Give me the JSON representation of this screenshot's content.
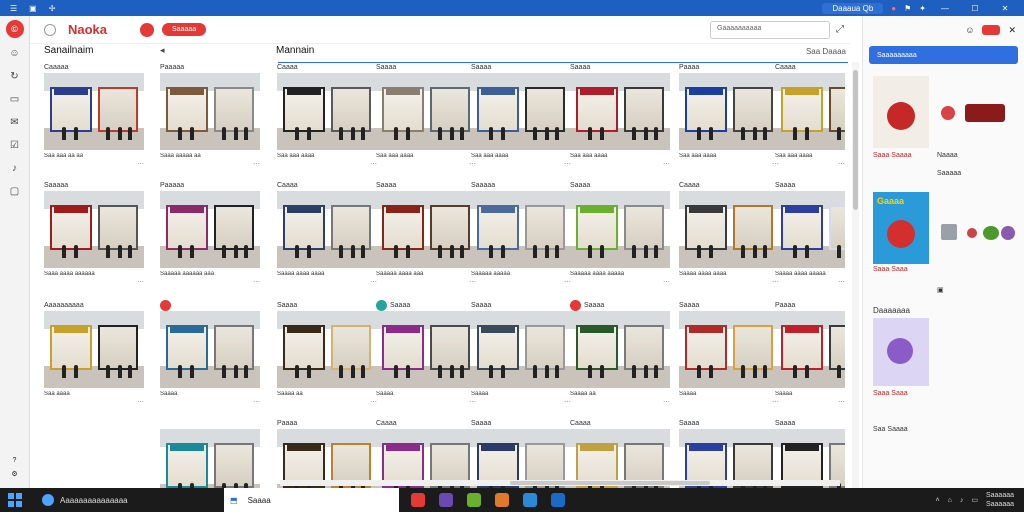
{
  "titlebar": {
    "title": "",
    "pill": "Daaaua Qb"
  },
  "header": {
    "brand": "Naoka",
    "pill_button": "Saaaaa",
    "search_placeholder": "Gaaaaaaaaaa"
  },
  "subheader": {
    "left": "Sanailnaim",
    "center": "Mannain",
    "right": "Saa Daaaa"
  },
  "rows": [
    {
      "cards": [
        {
          "title": "Caaaaa",
          "meta": "Saa aaa aa aa",
          "colors": [
            "#2c3e8f",
            "#c0392b"
          ]
        },
        {
          "title": "Paaaaa",
          "meta": "Saaa aaaaa aa",
          "colors": [
            "#7d5a3c",
            "#8a8a8a"
          ]
        },
        {
          "title": "Caaaa",
          "meta": "Saa aaa aaaa",
          "colors": [
            "#222222",
            "#5a5a5a"
          ]
        },
        {
          "title": "Saaaa",
          "meta": "Saa aaa aaaa",
          "colors": [
            "#8a7d72",
            "#5c6a76"
          ]
        },
        {
          "title": "Saaaa",
          "meta": "Saa aaa aaaa",
          "colors": [
            "#3c5f9a",
            "#2b2b2b"
          ]
        },
        {
          "title": "Saaaa",
          "meta": "Saa aaa aaaa",
          "colors": [
            "#b01c2a",
            "#3a3a3a"
          ]
        },
        {
          "title": "Paaaa",
          "meta": "Saa aaa aaaa",
          "colors": [
            "#1a3fa0",
            "#444"
          ]
        },
        {
          "title": "Caaaa",
          "meta": "Saa aaa aaaa",
          "colors": [
            "#c7a12a",
            "#6b4a2a"
          ]
        }
      ]
    },
    {
      "cards": [
        {
          "title": "Saaaaa",
          "meta": "Saaa aaaa aaaaaa",
          "colors": [
            "#a01c1c",
            "#555"
          ]
        },
        {
          "title": "Paaaaa",
          "meta": "Saaaaa aaaaaa aaa",
          "colors": [
            "#8c2b6a",
            "#222"
          ]
        },
        {
          "title": "Caaaa",
          "meta": "Saaaa aaaa aaaa",
          "colors": [
            "#2b3f6a",
            "#777"
          ]
        },
        {
          "title": "Saaaa",
          "meta": "Saaaaa aaaa aaa",
          "colors": [
            "#8a2418",
            "#5a3a2a"
          ]
        },
        {
          "title": "Saaaaa",
          "meta": "Saaaaa aaaaa",
          "colors": [
            "#4a6aa0",
            "#999"
          ]
        },
        {
          "title": "Saaaa",
          "meta": "Saaaaa aaaa aaaaa",
          "colors": [
            "#6ab02e",
            "#8a8a8a"
          ]
        },
        {
          "title": "Caaaa",
          "meta": "Saaaa aaaa aaaa",
          "colors": [
            "#3a3a3a",
            "#b0782a"
          ]
        },
        {
          "title": "Saaaa",
          "meta": "Saaaa aaaa aaaaa",
          "colors": [
            "#2a3fa0",
            "#d8d8e8"
          ]
        }
      ]
    },
    {
      "cards": [
        {
          "title": "Aaaaaaaaaa",
          "meta": "Saa aaaa",
          "colors": [
            "#c7a12a",
            "#222"
          ]
        },
        {
          "title": "",
          "meta": "Saaaa",
          "colors": [
            "#2a6a9a",
            "#777"
          ]
        },
        {
          "title": "Saaaa",
          "meta": "Saaaa aa",
          "colors": [
            "#3a2a1a",
            "#d8b070"
          ]
        },
        {
          "title": "Saaaa",
          "meta": "Saaaa",
          "colors": [
            "#8c2b8a",
            "#4a4a4a"
          ]
        },
        {
          "title": "Saaaa",
          "meta": "Saaaa",
          "colors": [
            "#3a4a5a",
            "#999"
          ]
        },
        {
          "title": "Saaaa",
          "meta": "Saaaa aa",
          "colors": [
            "#2a5a2a",
            "#7a7a7a"
          ]
        },
        {
          "title": "Saaaa",
          "meta": "Saaaa",
          "colors": [
            "#b02a2a",
            "#d8a040"
          ]
        },
        {
          "title": "Paaaa",
          "meta": "Saaaa",
          "colors": [
            "#c0202a",
            "#3a3a3a"
          ]
        }
      ]
    },
    {
      "cards": [
        {
          "title": "",
          "meta": "",
          "colors": [
            "#1a8a9a",
            "#777"
          ]
        },
        {
          "title": "Paaaa",
          "meta": "",
          "colors": [
            "#3a2a1a",
            "#c08030"
          ]
        },
        {
          "title": "Caaaa",
          "meta": "",
          "colors": [
            "#8c2b8a",
            "#777"
          ]
        },
        {
          "title": "Saaaa",
          "meta": "",
          "colors": [
            "#2a3a6a",
            "#999"
          ]
        },
        {
          "title": "Caaaa",
          "meta": "",
          "colors": [
            "#c0a040",
            "#777"
          ]
        },
        {
          "title": "Saaaa",
          "meta": "",
          "colors": [
            "#2a3fa0",
            "#3a3a3a"
          ]
        },
        {
          "title": "Saaaa",
          "meta": "",
          "colors": [
            "#222",
            "#777"
          ]
        }
      ]
    }
  ],
  "right_panel": {
    "bar_label": "Saaaaaaaaa",
    "item1_price": "Saaa Saaaa",
    "item1_label": "Naaaa",
    "item1_tag": "Saaaaa",
    "item2_title": "Gaaaa",
    "item2_price": "Saaa Saaa",
    "section_label": "Daaaaaaa",
    "item3_price": "Saaa Saaa",
    "footer": "Saa Saaaa"
  },
  "taskbar": {
    "search_text": "Aaaaaaaaaaaaaaa",
    "app1": "Saaaa",
    "clock_time": "Saaaaaa",
    "clock_date": "Saaaaaa"
  },
  "colors": {
    "accent": "#2f6fe0",
    "brand": "#d32f2f",
    "titlebar": "#1f5fbf",
    "taskbar": "#1b1b1b"
  }
}
